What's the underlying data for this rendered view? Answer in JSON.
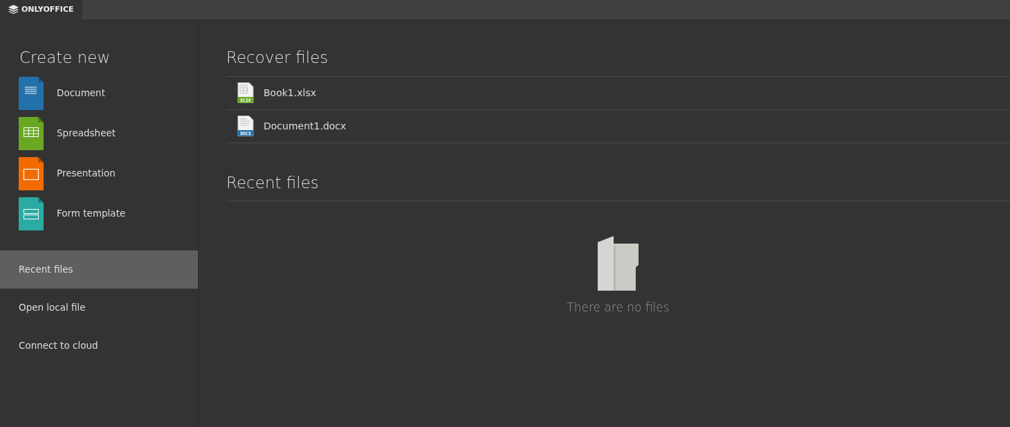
{
  "app_tab": {
    "title": "ONLYOFFICE",
    "selected": true
  },
  "create_new": {
    "title": "Create new",
    "items": [
      {
        "kind": "document",
        "label": "Document"
      },
      {
        "kind": "spreadsheet",
        "label": "Spreadsheet"
      },
      {
        "kind": "presentation",
        "label": "Presentation"
      },
      {
        "kind": "form",
        "label": "Form template"
      }
    ]
  },
  "sidebar": {
    "items": [
      {
        "label": "Recent files",
        "selected": true
      },
      {
        "label": "Open local file",
        "selected": false
      },
      {
        "label": "Connect to cloud",
        "selected": false
      }
    ]
  },
  "recover_files": {
    "title": "Recover files",
    "files": [
      {
        "kind": "spreadsheet",
        "badge": "XLSX",
        "name": "Book1.xlsx"
      },
      {
        "kind": "document",
        "badge": "DOCX",
        "name": "Document1.docx"
      }
    ]
  },
  "recent_files": {
    "title": "Recent files",
    "empty_message": "There are no files"
  }
}
